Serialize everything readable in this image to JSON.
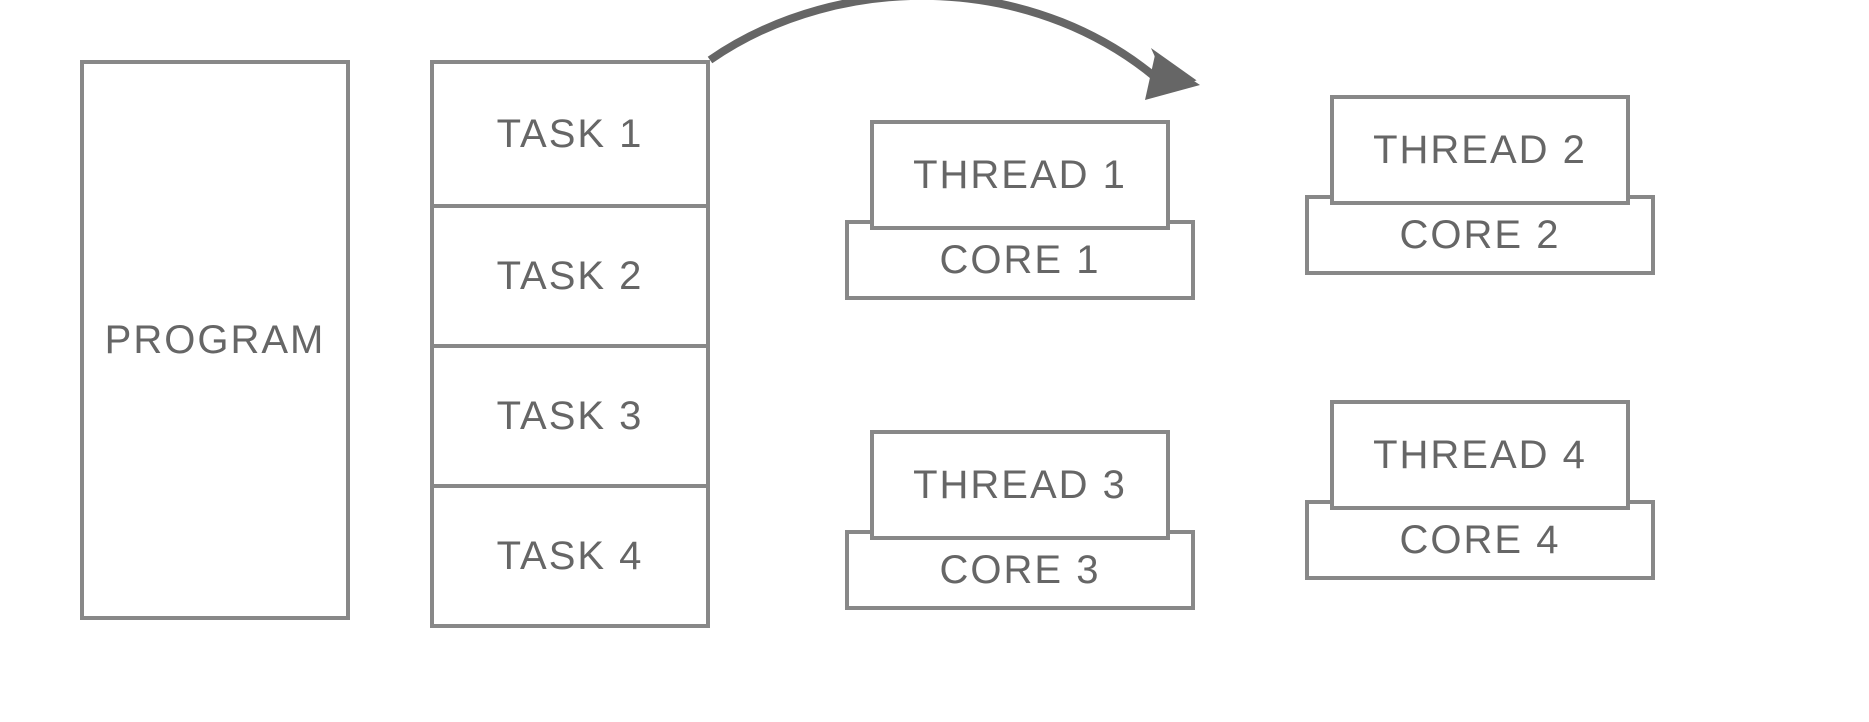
{
  "program": {
    "label": "PROGRAM"
  },
  "tasks": {
    "items": [
      {
        "label": "TASK 1"
      },
      {
        "label": "TASK 2"
      },
      {
        "label": "TASK 3"
      },
      {
        "label": "TASK 4"
      }
    ]
  },
  "units": {
    "u1": {
      "thread": "THREAD 1",
      "core": "CORE 1"
    },
    "u2": {
      "thread": "THREAD 2",
      "core": "CORE 2"
    },
    "u3": {
      "thread": "THREAD 3",
      "core": "CORE 3"
    },
    "u4": {
      "thread": "THREAD 4",
      "core": "CORE 4"
    }
  }
}
